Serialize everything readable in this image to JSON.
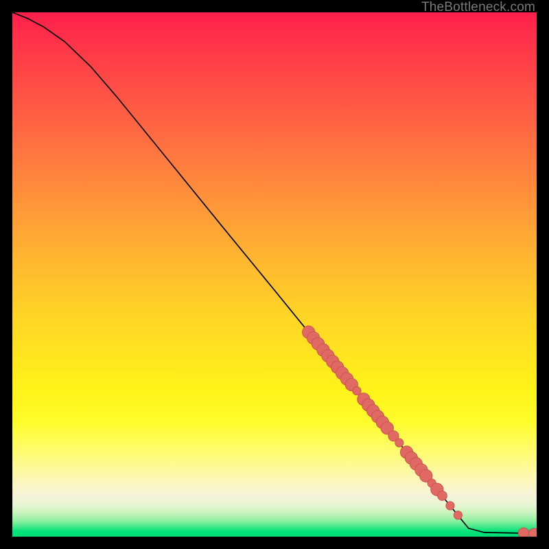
{
  "watermark": "TheBottleneck.com",
  "colors": {
    "page_bg": "#000000",
    "curve_stroke": "#000000",
    "marker_fill": "#e06a63",
    "marker_stroke": "#c9524c"
  },
  "chart_data": {
    "type": "line",
    "title": "",
    "xlabel": "",
    "ylabel": "",
    "xlim": [
      0,
      100
    ],
    "ylim": [
      0,
      100
    ],
    "grid": false,
    "curve": [
      {
        "x": 0.0,
        "y": 100.0
      },
      {
        "x": 3.0,
        "y": 98.8
      },
      {
        "x": 6.0,
        "y": 97.2
      },
      {
        "x": 10.0,
        "y": 94.4
      },
      {
        "x": 15.0,
        "y": 89.6
      },
      {
        "x": 20.0,
        "y": 83.8
      },
      {
        "x": 30.0,
        "y": 71.5
      },
      {
        "x": 40.0,
        "y": 59.2
      },
      {
        "x": 50.0,
        "y": 47.0
      },
      {
        "x": 60.0,
        "y": 34.7
      },
      {
        "x": 70.0,
        "y": 22.5
      },
      {
        "x": 80.0,
        "y": 10.2
      },
      {
        "x": 87.0,
        "y": 1.6
      },
      {
        "x": 90.0,
        "y": 0.8
      },
      {
        "x": 95.0,
        "y": 0.7
      },
      {
        "x": 100.0,
        "y": 0.6
      }
    ],
    "markers": [
      {
        "x": 56.5,
        "y": 39.0,
        "r": 1.2
      },
      {
        "x": 57.4,
        "y": 37.9,
        "r": 1.2
      },
      {
        "x": 58.3,
        "y": 36.8,
        "r": 1.2
      },
      {
        "x": 59.3,
        "y": 35.6,
        "r": 1.2
      },
      {
        "x": 60.2,
        "y": 34.5,
        "r": 1.2
      },
      {
        "x": 61.1,
        "y": 33.4,
        "r": 1.2
      },
      {
        "x": 62.0,
        "y": 32.3,
        "r": 1.2
      },
      {
        "x": 62.9,
        "y": 31.2,
        "r": 1.2
      },
      {
        "x": 63.8,
        "y": 30.1,
        "r": 1.2
      },
      {
        "x": 64.7,
        "y": 29.0,
        "r": 1.2
      },
      {
        "x": 65.7,
        "y": 27.8,
        "r": 0.8
      },
      {
        "x": 67.0,
        "y": 26.2,
        "r": 1.2
      },
      {
        "x": 67.9,
        "y": 25.1,
        "r": 1.2
      },
      {
        "x": 68.8,
        "y": 24.0,
        "r": 1.2
      },
      {
        "x": 69.7,
        "y": 22.9,
        "r": 1.2
      },
      {
        "x": 70.6,
        "y": 21.8,
        "r": 1.2
      },
      {
        "x": 71.5,
        "y": 20.7,
        "r": 1.2
      },
      {
        "x": 72.7,
        "y": 19.2,
        "r": 1.0
      },
      {
        "x": 73.8,
        "y": 17.9,
        "r": 0.8
      },
      {
        "x": 75.2,
        "y": 16.1,
        "r": 1.2
      },
      {
        "x": 76.1,
        "y": 15.0,
        "r": 1.2
      },
      {
        "x": 77.0,
        "y": 13.9,
        "r": 1.2
      },
      {
        "x": 78.0,
        "y": 12.7,
        "r": 1.2
      },
      {
        "x": 78.9,
        "y": 11.6,
        "r": 1.2
      },
      {
        "x": 80.0,
        "y": 10.2,
        "r": 0.8
      },
      {
        "x": 81.0,
        "y": 9.0,
        "r": 1.2
      },
      {
        "x": 82.0,
        "y": 7.8,
        "r": 0.9
      },
      {
        "x": 83.5,
        "y": 5.9,
        "r": 0.8
      },
      {
        "x": 85.0,
        "y": 4.1,
        "r": 0.8
      },
      {
        "x": 97.5,
        "y": 0.7,
        "r": 1.0
      },
      {
        "x": 99.5,
        "y": 0.6,
        "r": 1.0
      }
    ]
  }
}
